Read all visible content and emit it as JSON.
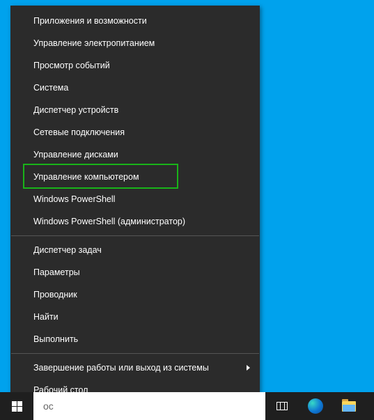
{
  "menu": {
    "groups": [
      [
        {
          "id": "apps-features",
          "label": "Приложения и возможности"
        },
        {
          "id": "power-options",
          "label": "Управление электропитанием"
        },
        {
          "id": "event-viewer",
          "label": "Просмотр событий"
        },
        {
          "id": "system",
          "label": "Система"
        },
        {
          "id": "device-manager",
          "label": "Диспетчер устройств"
        },
        {
          "id": "network-connections",
          "label": "Сетевые подключения"
        },
        {
          "id": "disk-management",
          "label": "Управление дисками"
        },
        {
          "id": "computer-management",
          "label": "Управление компьютером",
          "highlighted": true
        },
        {
          "id": "powershell",
          "label": "Windows PowerShell"
        },
        {
          "id": "powershell-admin",
          "label": "Windows PowerShell (администратор)"
        }
      ],
      [
        {
          "id": "task-manager",
          "label": "Диспетчер задач"
        },
        {
          "id": "settings",
          "label": "Параметры"
        },
        {
          "id": "file-explorer",
          "label": "Проводник"
        },
        {
          "id": "search",
          "label": "Найти"
        },
        {
          "id": "run",
          "label": "Выполнить"
        }
      ],
      [
        {
          "id": "shutdown-signout",
          "label": "Завершение работы или выход из системы",
          "submenu": true
        },
        {
          "id": "desktop",
          "label": "Рабочий стол"
        }
      ]
    ]
  },
  "taskbar": {
    "search_visible_text": "ос"
  }
}
